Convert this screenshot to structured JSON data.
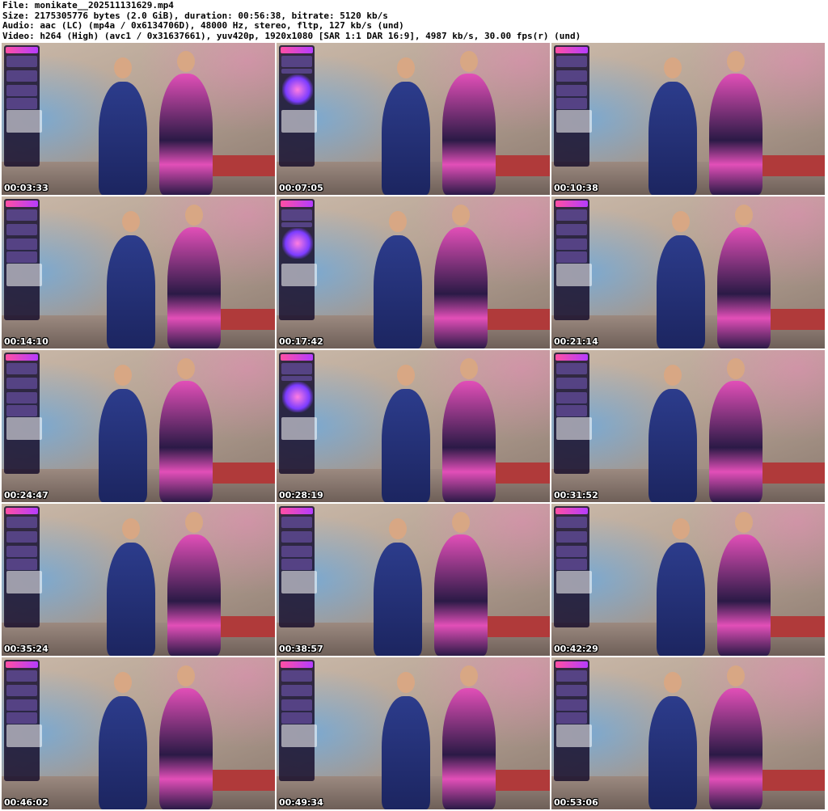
{
  "header": {
    "line1": "File: monikate__202511131629.mp4",
    "line2": "Size: 2175305776 bytes (2.0 GiB), duration: 00:56:38, bitrate: 5120 kb/s",
    "line3": "Audio: aac (LC) (mp4a / 0x6134706D), 48000 Hz, stereo, fltp, 127 kb/s (und)",
    "line4": "Video: h264 (High) (avc1 / 0x31637661), yuv420p, 1920x1080 [SAR 1:1 DAR 16:9], 4987 kb/s, 30.00 fps(r) (und)"
  },
  "thumbnails": [
    {
      "timestamp": "00:03:33"
    },
    {
      "timestamp": "00:07:05"
    },
    {
      "timestamp": "00:10:38"
    },
    {
      "timestamp": "00:14:10"
    },
    {
      "timestamp": "00:17:42"
    },
    {
      "timestamp": "00:21:14"
    },
    {
      "timestamp": "00:24:47"
    },
    {
      "timestamp": "00:28:19"
    },
    {
      "timestamp": "00:31:52"
    },
    {
      "timestamp": "00:35:24"
    },
    {
      "timestamp": "00:38:57"
    },
    {
      "timestamp": "00:42:29"
    },
    {
      "timestamp": "00:46:02"
    },
    {
      "timestamp": "00:49:34"
    },
    {
      "timestamp": "00:53:06"
    }
  ]
}
